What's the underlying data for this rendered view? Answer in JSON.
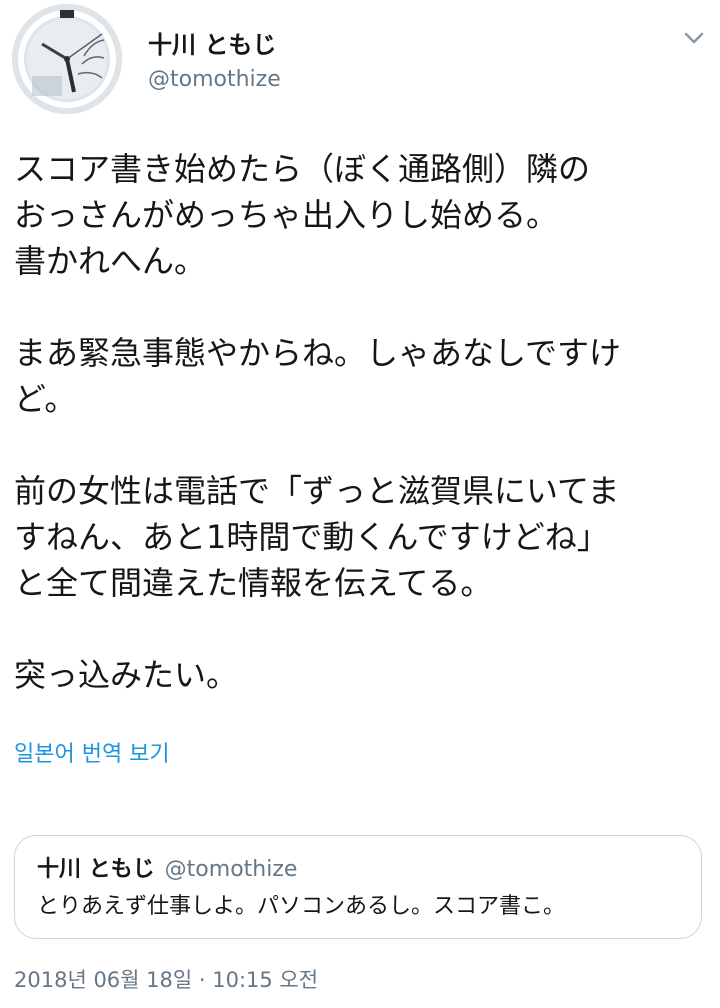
{
  "user": {
    "display_name": "十川 ともじ",
    "handle": "@tomothize",
    "avatar_icon": "clock-avatar-icon"
  },
  "menu_icon": "chevron-down-icon",
  "tweet": {
    "text": "スコア書き始めたら（ぼく通路側）隣の\nおっさんがめっちゃ出入りし始める。\n書かれへん。\n\nまあ緊急事態やからね。しゃあなしですけ\nど。\n\n前の女性は電話で「ずっと滋賀県にいてま\nすねん、あと1時間で動くんですけどね」\nと全て間違えた情報を伝えてる。\n\n突っ込みたい。"
  },
  "translate_link": "일본어 번역 보기",
  "quote": {
    "display_name": "十川 ともじ",
    "handle": "@tomothize",
    "text": "とりあえず仕事しよ。パソコンあるし。スコア書こ。"
  },
  "timestamp": "2018년 06월 18일 · 10:15 오전",
  "colors": {
    "link": "#1b95e0",
    "secondary_text": "#657786",
    "border": "#ccd6dd"
  }
}
